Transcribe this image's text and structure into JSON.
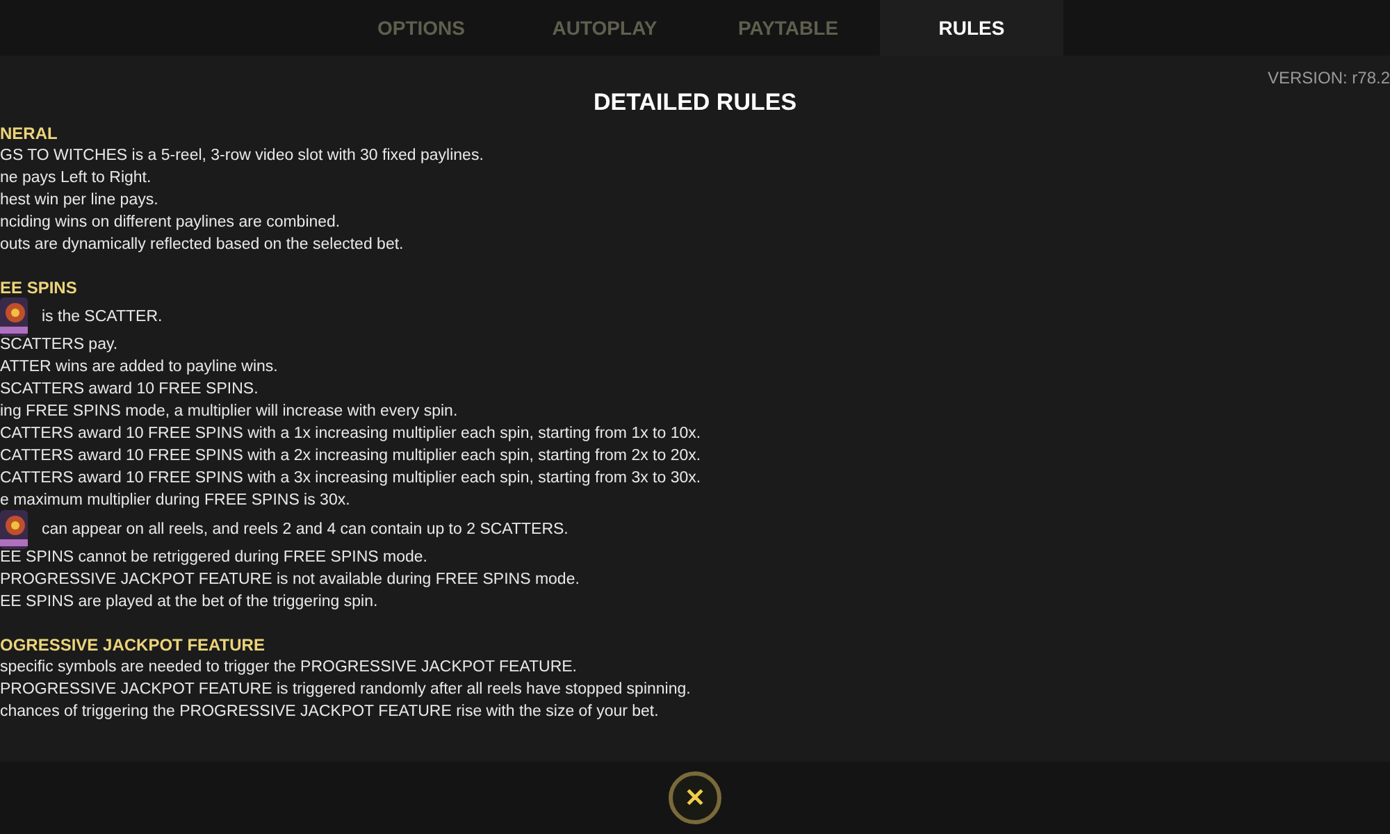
{
  "tabs": [
    {
      "label": "OPTIONS",
      "selected": false
    },
    {
      "label": "AUTOPLAY",
      "selected": false
    },
    {
      "label": "PAYTABLE",
      "selected": false
    },
    {
      "label": "RULES",
      "selected": true
    }
  ],
  "version": "VERSION: r78.2",
  "title": "DETAILED RULES",
  "sections": [
    {
      "heading": "NERAL",
      "lines": [
        {
          "kind": "text",
          "text": "GS TO WITCHES is a 5-reel, 3-row video slot with 30 fixed paylines."
        },
        {
          "kind": "text",
          "text": "ne pays Left to Right."
        },
        {
          "kind": "text",
          "text": "hest win per line pays."
        },
        {
          "kind": "text",
          "text": "nciding wins on different paylines are combined."
        },
        {
          "kind": "text",
          "text": "outs are dynamically reflected based on the selected bet."
        }
      ]
    },
    {
      "heading": "EE SPINS",
      "lines": [
        {
          "kind": "symbol",
          "text": "is the SCATTER."
        },
        {
          "kind": "text",
          "text": "SCATTERS pay."
        },
        {
          "kind": "text",
          "text": "ATTER wins are added to payline wins."
        },
        {
          "kind": "text",
          "text": "SCATTERS award 10 FREE SPINS."
        },
        {
          "kind": "text",
          "text": "ing FREE SPINS mode, a multiplier will increase with every spin."
        },
        {
          "kind": "text",
          "text": "CATTERS award 10 FREE SPINS with a 1x increasing multiplier each spin, starting from 1x to 10x."
        },
        {
          "kind": "text",
          "text": "CATTERS award 10 FREE SPINS with a 2x increasing multiplier each spin, starting from 2x to 20x."
        },
        {
          "kind": "text",
          "text": "CATTERS award 10 FREE SPINS with a 3x increasing multiplier each spin, starting from 3x to 30x."
        },
        {
          "kind": "text",
          "text": "e maximum multiplier during FREE SPINS is 30x."
        },
        {
          "kind": "symbol",
          "text": "can appear on all reels, and reels 2 and 4 can contain up to 2 SCATTERS."
        },
        {
          "kind": "text",
          "text": "EE SPINS cannot be retriggered during FREE SPINS mode."
        },
        {
          "kind": "text",
          "text": "PROGRESSIVE JACKPOT FEATURE is not available during FREE SPINS mode."
        },
        {
          "kind": "text",
          "text": "EE SPINS are played at the bet of the triggering spin."
        }
      ]
    },
    {
      "heading": "OGRESSIVE JACKPOT FEATURE",
      "lines": [
        {
          "kind": "text",
          "text": "specific symbols are needed to trigger the PROGRESSIVE JACKPOT FEATURE."
        },
        {
          "kind": "text",
          "text": "PROGRESSIVE JACKPOT FEATURE is triggered randomly after all reels have stopped spinning."
        },
        {
          "kind": "text",
          "text": "chances of triggering the PROGRESSIVE JACKPOT FEATURE rise with the size of your bet."
        }
      ]
    }
  ],
  "close": {
    "label": "✕"
  }
}
